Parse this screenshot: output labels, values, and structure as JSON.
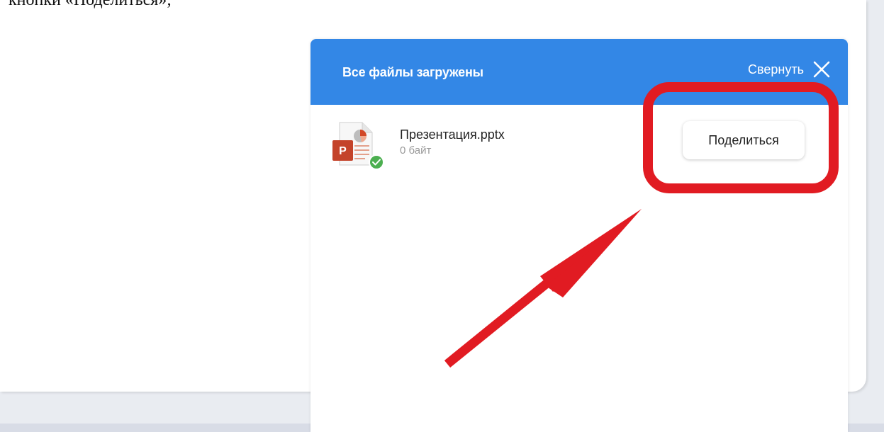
{
  "page": {
    "top_text": "кнопки «Поделиться»;"
  },
  "upload_dialog": {
    "title": "Все файлы загружены",
    "collapse_label": "Свернуть",
    "file": {
      "name": "Презентация.pptx",
      "size": "0 байт",
      "type_letter": "P"
    },
    "share_label": "Поделиться"
  },
  "colors": {
    "header_blue": "#3387e6",
    "annotation_red": "#e11b22",
    "success_green": "#4caf50",
    "powerpoint_orange": "#c4432a"
  },
  "icons": {
    "close": "close-icon",
    "file": "pptx-file-icon",
    "status": "check-badge-icon"
  }
}
